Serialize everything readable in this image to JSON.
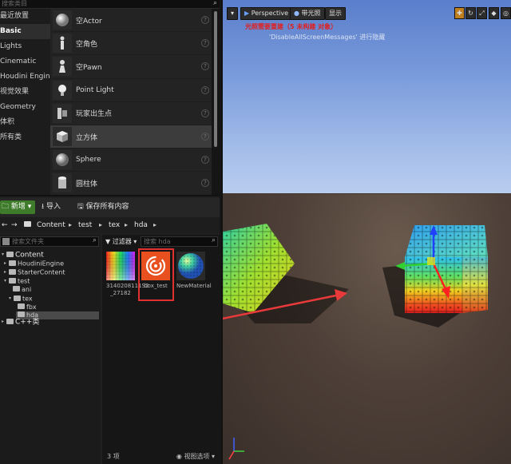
{
  "place_actors": {
    "search_placeholder": "搜索类目",
    "categories": [
      "最近放置",
      "Basic",
      "Lights",
      "Cinematic",
      "Houdini Engine",
      "视觉效果",
      "Geometry",
      "体积",
      "所有类"
    ],
    "active_category": "Basic",
    "actors": [
      "空Actor",
      "空角色",
      "空Pawn",
      "Point Light",
      "玩家出生点",
      "立方体",
      "Sphere",
      "圆柱体"
    ],
    "selected_actor": "立方体"
  },
  "content_browser": {
    "toolbar": {
      "new_label": "新增",
      "import_label": "导入",
      "save_all_label": "保存所有内容"
    },
    "breadcrumbs": [
      "Content",
      "test",
      "tex",
      "hda"
    ],
    "tree_search_placeholder": "搜索文件夹",
    "tree": {
      "content": "Content",
      "houdini_engine": "HoudiniEngine",
      "starter_content": "StarterContent",
      "test": "test",
      "ani": "ani",
      "tex": "tex",
      "fbx": "fbx",
      "hda": "hda",
      "cpp": "C++类"
    },
    "filter_label": "过滤器",
    "asset_search_placeholder": "搜索 hda",
    "assets": [
      {
        "name_line1": "3140208111S2",
        "name_line2": "_27182"
      },
      {
        "name_line1": "box_test",
        "name_line2": ""
      },
      {
        "name_line1": "NewMaterial",
        "name_line2": ""
      }
    ],
    "item_count": "3 项",
    "view_options": "视图选项"
  },
  "viewport": {
    "perspective_label": "Perspective",
    "lit_label": "带光照",
    "show_label": "显示",
    "warning": "光照需要重建（5 未构建 对象）",
    "hint": "'DisableAllScreenMessages' 进行隐藏"
  },
  "colors": {
    "accent_green": "#3e7b2a",
    "highlight_red": "#e03030",
    "warning_red": "#e02020"
  }
}
